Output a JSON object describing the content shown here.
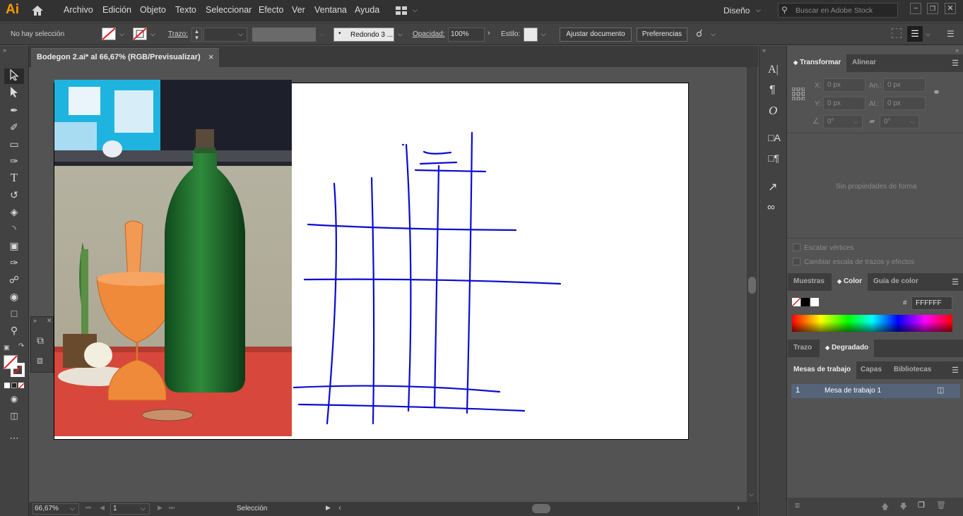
{
  "app": {
    "logo": "Ai"
  },
  "menu": [
    "Archivo",
    "Edición",
    "Objeto",
    "Texto",
    "Seleccionar",
    "Efecto",
    "Ver",
    "Ventana",
    "Ayuda"
  ],
  "workspace": "Diseño",
  "search": {
    "placeholder": "Buscar en Adobe Stock"
  },
  "control": {
    "selection": "No hay selección",
    "stroke_label": "Trazo:",
    "brush": "Redondo 3 ...",
    "opacity_label": "Opacidad:",
    "opacity_value": "100%",
    "style_label": "Estilo:",
    "fit_button": "Ajustar documento",
    "prefs_button": "Preferencias"
  },
  "document": {
    "tab_title": "Bodegon 2.ai* al 66,67% (RGB/Previsualizar)",
    "close": "×"
  },
  "status": {
    "zoom": "66,67%",
    "artboard_num": "1",
    "tool": "Selección"
  },
  "transform_panel": {
    "tabs": [
      "Transformar",
      "Alinear"
    ],
    "x_label": "X:",
    "x_value": "0 px",
    "y_label": "Y:",
    "y_value": "0 px",
    "w_label": "An.:",
    "w_value": "0 px",
    "h_label": "Al.:",
    "h_value": "0 px",
    "rot_value": "0°",
    "shear_value": "0°",
    "empty_msg": "Sin propiedades de forma",
    "scale_corners": "Escalar vértices",
    "scale_strokes": "Cambiar escala de trazos y efectos"
  },
  "color_panel": {
    "tabs": [
      "Muestras",
      "Color",
      "Guía de color"
    ],
    "hash": "#",
    "hex": "FFFFFF"
  },
  "stroke_panel": {
    "tabs": [
      "Trazo",
      "Degradado"
    ]
  },
  "artboards_panel": {
    "tabs": [
      "Mesas de trabajo",
      "Capas",
      "Bibliotecas"
    ],
    "rows": [
      {
        "num": "1",
        "name": "Mesa de trabajo 1"
      }
    ]
  },
  "colors": {
    "ui_dark": "#323232",
    "panel": "#535353",
    "sketch_line": "#0a0ad0",
    "table_red": "#d8473b",
    "bottle_green": "#1f6a2a",
    "mortar_orange": "#ef8a3a"
  }
}
